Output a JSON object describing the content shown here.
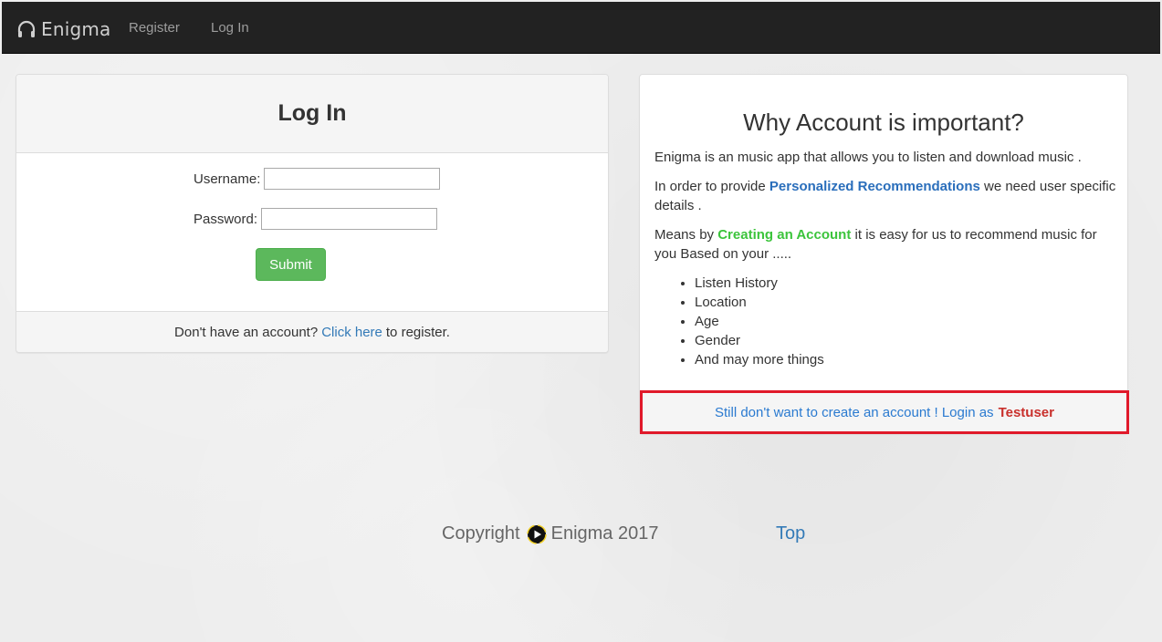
{
  "navbar": {
    "brand": "Enigma",
    "links": [
      "Register",
      "Log In"
    ]
  },
  "login": {
    "title": "Log In",
    "username_label": "Username:",
    "username_value": "",
    "password_label": "Password:",
    "password_value": "",
    "submit_label": "Submit",
    "footer_prefix": "Don't have an account?",
    "footer_link": "Click here",
    "footer_suffix": "to register."
  },
  "info": {
    "title": "Why Account is important?",
    "p1": "Enigma is an music app that allows you to listen and download music .",
    "p2_prefix": "In order to provide",
    "p2_highlight": "Personalized Recommendations",
    "p2_suffix": "we need user specific details .",
    "p3_prefix": "Means by",
    "p3_highlight": "Creating an Account",
    "p3_suffix": "it is easy for us to recommend music for you Based on your .....",
    "list": [
      "Listen History",
      "Location",
      "Age",
      "Gender",
      "And may more things"
    ],
    "test_link": "Still don't want to create an account ! Login as",
    "test_user": "Testuser"
  },
  "footer": {
    "copyright_prefix": "Copyright",
    "copyright_suffix": "Enigma 2017",
    "top_link": "Top"
  },
  "colors": {
    "navbar_bg": "#222222",
    "submit_green": "#5cb85c",
    "link_blue": "#337ab7",
    "highlight_green": "#3cc43c",
    "highlight_box_red": "#e0192a",
    "testuser_red": "#c9302c"
  }
}
